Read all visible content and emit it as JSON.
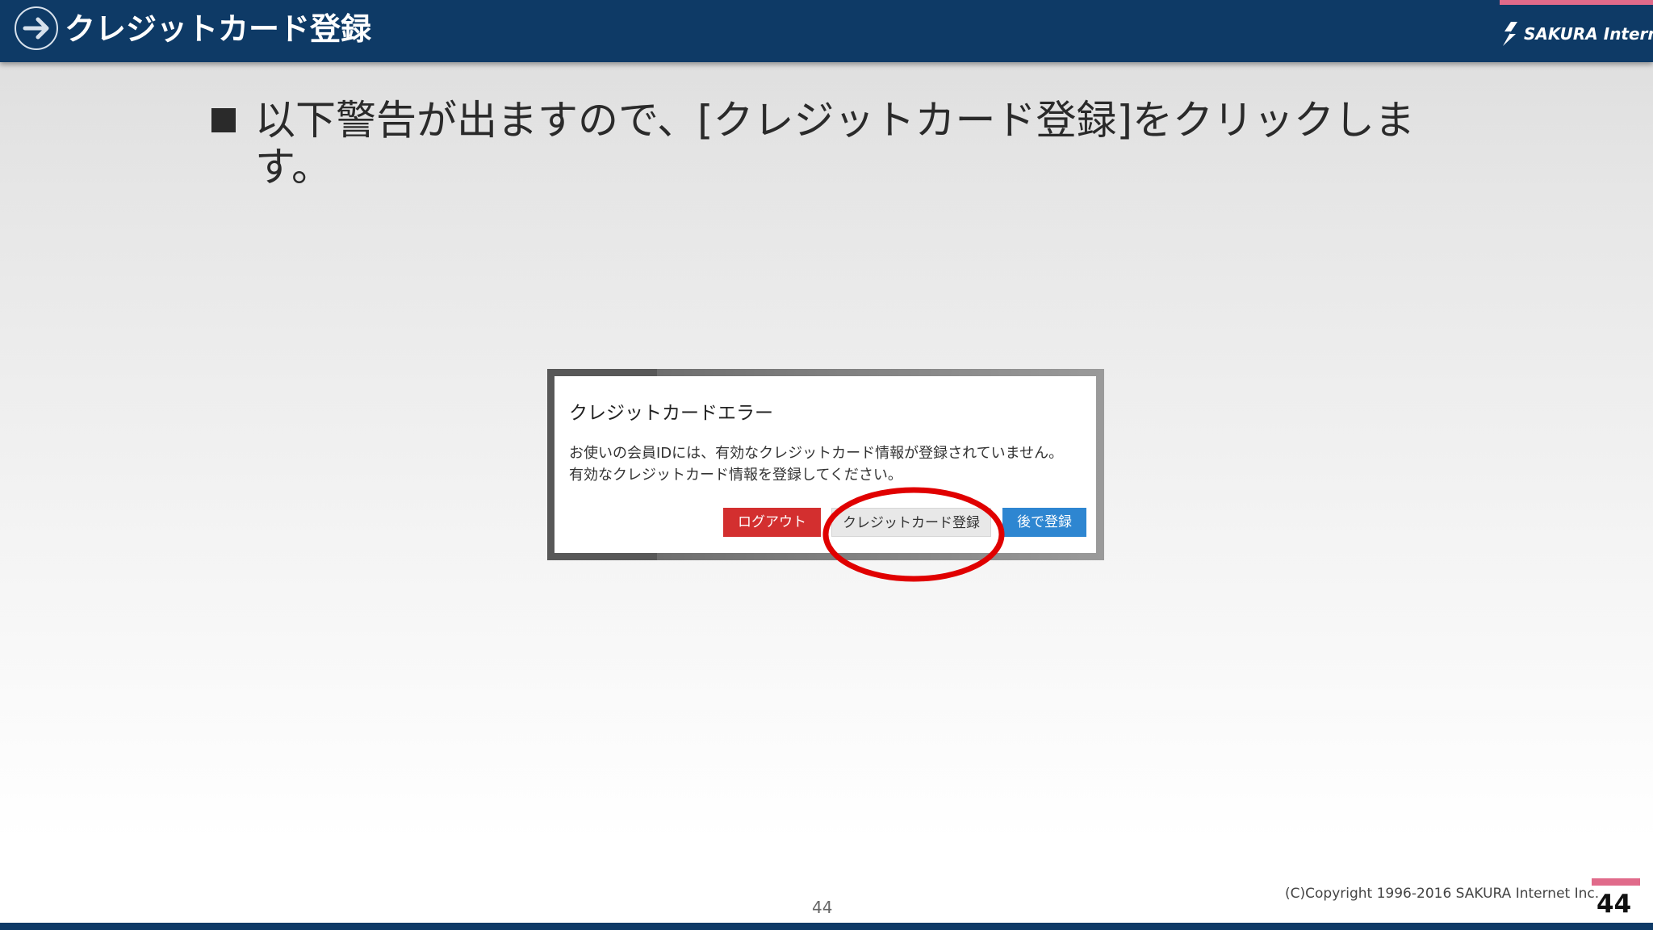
{
  "header": {
    "title": "クレジットカード登録",
    "logo_text": "SAKURA Internet",
    "brand_color": "#0e3a66",
    "accent_color": "#e06a8a",
    "nav_icon": "arrow-right-circle-icon"
  },
  "bullet": {
    "text": "以下警告が出ますので、[クレジットカード登録]をクリックします。"
  },
  "dialog": {
    "title": "クレジットカードエラー",
    "message_line1": "お使いの会員IDには、有効なクレジットカード情報が登録されていません。",
    "message_line2": "有効なクレジットカード情報を登録してください。",
    "buttons": {
      "logout": "ログアウト",
      "register": "クレジットカード登録",
      "later": "後で登録"
    },
    "highlight": "register",
    "highlight_color": "#e00000"
  },
  "footer": {
    "page_number_center": "44",
    "copyright": "(C)Copyright 1996-2016 SAKURA Internet Inc.",
    "page_number_right": "44"
  }
}
